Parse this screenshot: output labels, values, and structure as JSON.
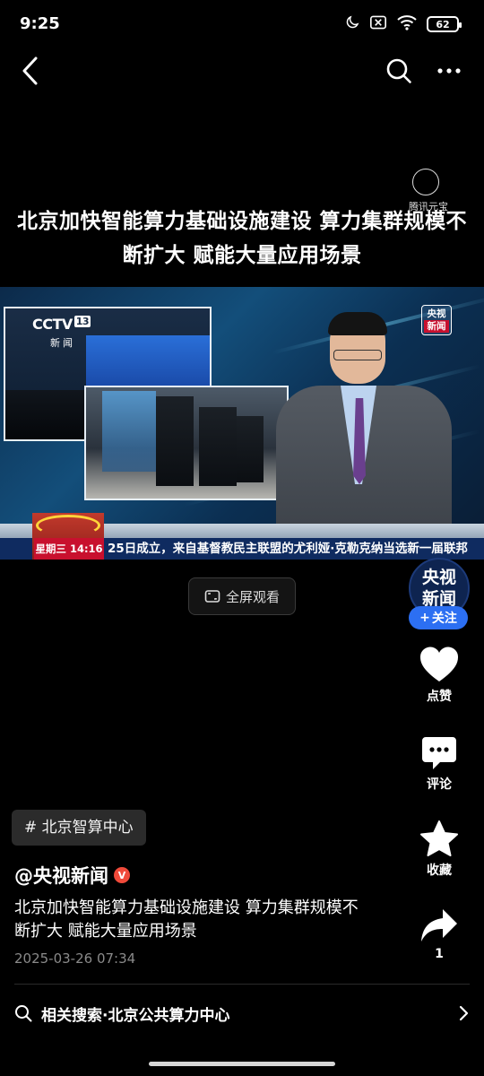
{
  "status_bar": {
    "time": "9:25",
    "battery": "62",
    "icons": [
      "moon-icon",
      "sim-x-icon",
      "wifi-icon",
      "battery-icon"
    ]
  },
  "nav": {
    "icons": [
      "back-icon",
      "search-icon",
      "more-icon"
    ]
  },
  "watermark": "腾讯元宝",
  "headline": "北京加快智能算力基础设施建设 算力集群规模不断扩大 赋能大量应用场景",
  "video": {
    "logo": "CCTV",
    "logo_channel": "13",
    "logo_sub": "新闻",
    "corner_badge_top": "央视",
    "corner_badge_bottom": "新闻",
    "ticker_day": "星期三  14:16",
    "ticker_text": "25日成立，来自基督教民主联盟的尤利娅·克勒克纳当选新一届联邦"
  },
  "fullscreen_label": "全屏观看",
  "channel": {
    "avatar_line1": "央视",
    "avatar_line2": "新闻",
    "follow_label": "关注"
  },
  "rail": {
    "like_label": "点赞",
    "comment_label": "评论",
    "favorite_label": "收藏",
    "share_count": "1"
  },
  "post": {
    "hashtag": "# 北京智算中心",
    "author": "@央视新闻",
    "verified_mark": "V",
    "description": "北京加快智能算力基础设施建设 算力集群规模不断扩大 赋能大量应用场景",
    "time": "2025-03-26 07:34"
  },
  "related_search": "相关搜索·北京公共算力中心",
  "colors": {
    "background": "#000000",
    "follow_button": "#2c6ff2",
    "verified": "#f04a3a",
    "ticker_bar": "#0f2b60",
    "ticker_day": "#c8102e"
  }
}
